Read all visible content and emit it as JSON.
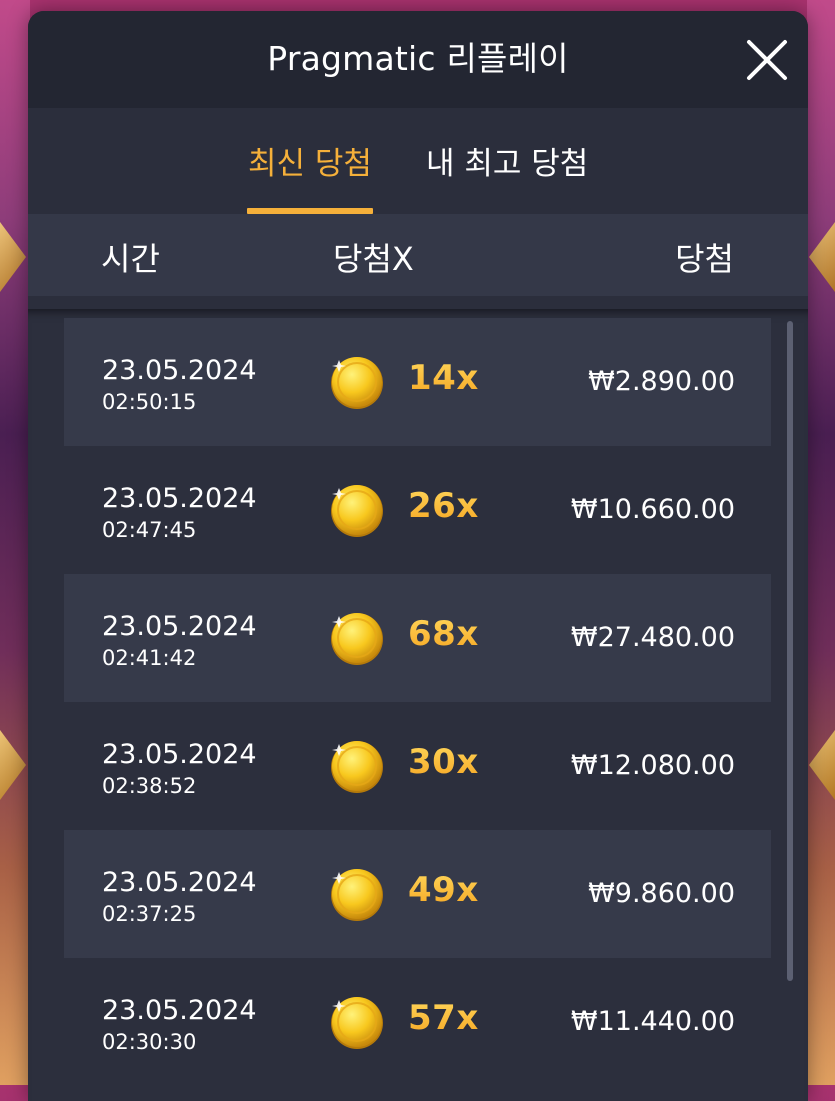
{
  "modal": {
    "title": "Pragmatic 리플레이"
  },
  "tabs": [
    {
      "label": "최신 당첨",
      "active": true
    },
    {
      "label": "내 최고 당첨",
      "active": false
    }
  ],
  "columns": {
    "time": "시간",
    "multiplier": "당첨X",
    "win": "당첨"
  },
  "rows": [
    {
      "date": "23.05.2024",
      "time": "02:50:15",
      "multiplier": "14x",
      "amount": "₩2.890.00"
    },
    {
      "date": "23.05.2024",
      "time": "02:47:45",
      "multiplier": "26x",
      "amount": "₩10.660.00"
    },
    {
      "date": "23.05.2024",
      "time": "02:41:42",
      "multiplier": "68x",
      "amount": "₩27.480.00"
    },
    {
      "date": "23.05.2024",
      "time": "02:38:52",
      "multiplier": "30x",
      "amount": "₩12.080.00"
    },
    {
      "date": "23.05.2024",
      "time": "02:37:25",
      "multiplier": "49x",
      "amount": "₩9.860.00"
    },
    {
      "date": "23.05.2024",
      "time": "02:30:30",
      "multiplier": "57x",
      "amount": "₩11.440.00"
    }
  ],
  "icons": {
    "close": "close-icon",
    "coin": "gold-coin-icon"
  },
  "colors": {
    "accent": "#f5b03a",
    "modal_bg": "#2b2e3c",
    "header_bg": "#232632",
    "row_shaded": "#363a4a"
  }
}
